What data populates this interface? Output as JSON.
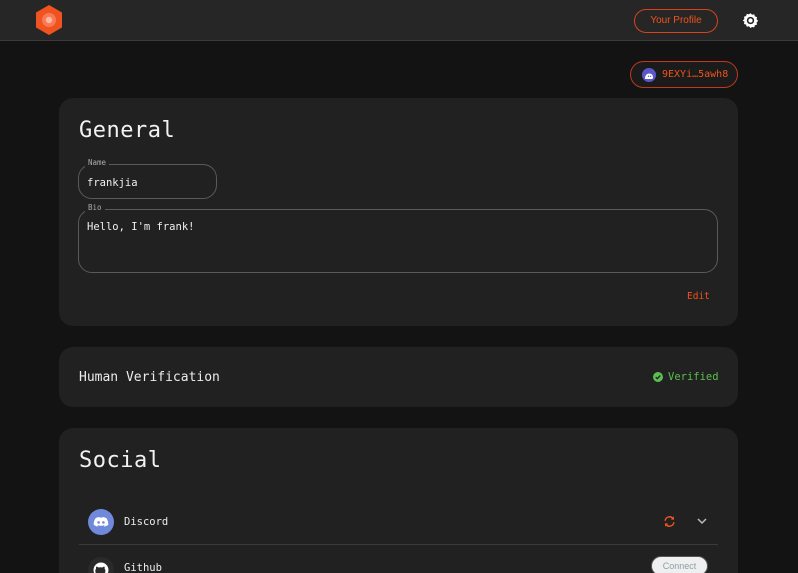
{
  "header": {
    "logo_icon": "hexagon-logo-icon",
    "profile_button": "Your Profile",
    "settings_icon": "gear-icon",
    "accent": "#f0531f"
  },
  "wallet": {
    "icon": "phantom-ghost-icon",
    "address": "9EXYi…5awh8"
  },
  "general": {
    "title": "General",
    "name_label": "Name",
    "name_value": "frankjia",
    "bio_label": "Bio",
    "bio_value": "Hello, I'm frank!",
    "edit_label": "Edit"
  },
  "human_verification": {
    "title": "Human Verification",
    "status": "Verified",
    "status_color": "#5bbf4f",
    "status_icon": "check-circle-icon"
  },
  "social": {
    "title": "Social",
    "items": [
      {
        "name": "Discord",
        "icon": "discord-icon",
        "action_icon": "sync-icon",
        "expand_icon": "chevron-down-icon"
      },
      {
        "name": "Github",
        "icon": "github-icon",
        "action": "Connect"
      }
    ]
  }
}
